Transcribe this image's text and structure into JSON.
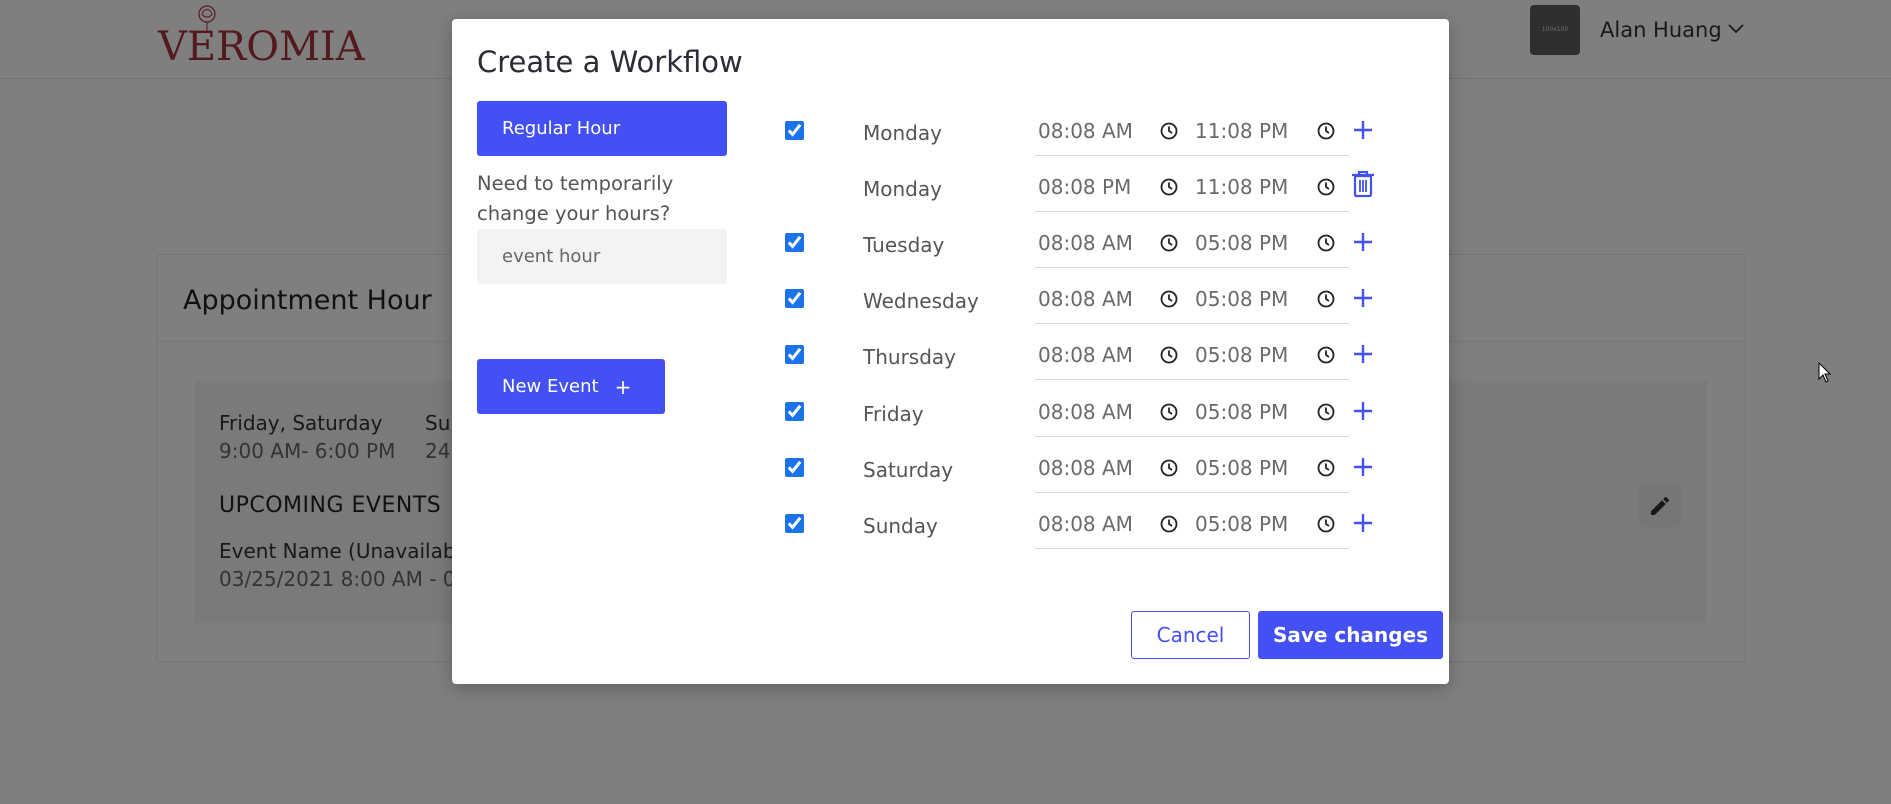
{
  "header": {
    "logo_text": "VEROMIA",
    "avatar_text": "100x100",
    "user_name": "Alan Huang"
  },
  "background": {
    "card_title": "Appointment Hour",
    "schedule": [
      {
        "days": "Friday, Saturday",
        "time": "9:00 AM- 6:00 PM"
      },
      {
        "days": "Su",
        "time": "24"
      }
    ],
    "upcoming_label": "UPCOMING EVENTS",
    "event_name": "Event Name (Unavailabl",
    "event_time": "03/25/2021 8:00 AM - 0"
  },
  "modal": {
    "title": "Create a Workflow",
    "regular_hour_label": "Regular Hour",
    "temp_note": "Need to temporarily change your hours?",
    "event_hour_placeholder": "event hour",
    "new_event_label": "New Event",
    "new_event_icon": "+",
    "cancel_label": "Cancel",
    "save_label": "Save changes",
    "rows": [
      {
        "checked": true,
        "day": "Monday",
        "from": "08:08  AM",
        "to": "11:08  PM",
        "action": "add"
      },
      {
        "checked": null,
        "day": "Monday",
        "from": "08:08  PM",
        "to": "11:08  PM",
        "action": "delete"
      },
      {
        "checked": true,
        "day": "Tuesday",
        "from": "08:08  AM",
        "to": "05:08  PM",
        "action": "add"
      },
      {
        "checked": true,
        "day": "Wednesday",
        "from": "08:08  AM",
        "to": "05:08  PM",
        "action": "add"
      },
      {
        "checked": true,
        "day": "Thursday",
        "from": "08:08  AM",
        "to": "05:08  PM",
        "action": "add"
      },
      {
        "checked": true,
        "day": "Friday",
        "from": "08:08  AM",
        "to": "05:08  PM",
        "action": "add"
      },
      {
        "checked": true,
        "day": "Saturday",
        "from": "08:08  AM",
        "to": "05:08  PM",
        "action": "add"
      },
      {
        "checked": true,
        "day": "Sunday",
        "from": "08:08  AM",
        "to": "05:08  PM",
        "action": "add"
      }
    ]
  },
  "colors": {
    "accent": "#4350f4",
    "checkbox": "#1a73e8",
    "brand": "#a8323e",
    "overlay": "rgba(0,0,0,0.5)"
  }
}
